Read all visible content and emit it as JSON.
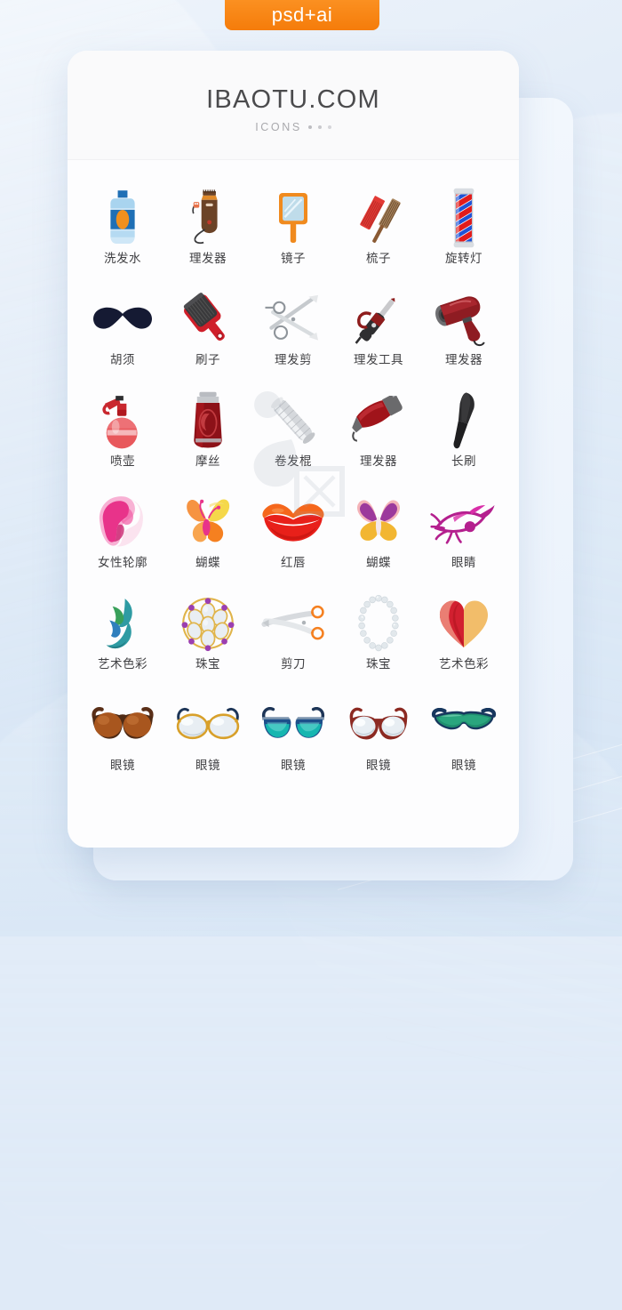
{
  "badge": {
    "label": "psd+ai",
    "color": "#f57c0a"
  },
  "card": {
    "title": "IBAOTU.COM",
    "subtitle": "ICONS"
  },
  "theme": {
    "background_top": "#eef4fb",
    "background_bottom": "#d3e3f4",
    "card_bg": "#fdfdfe",
    "label_color": "#3f3f42",
    "title_color": "#4b4b4d"
  },
  "grid": {
    "columns": 5,
    "rows": 6,
    "items": [
      {
        "label": "洗发水",
        "icon": "shampoo-bottle-icon",
        "colors": [
          "#1b6fb8",
          "#b9ddf5",
          "#f08a1e"
        ]
      },
      {
        "label": "理发器",
        "icon": "hair-clipper-icon",
        "colors": [
          "#6b4327",
          "#e08a2a",
          "#c0392b"
        ]
      },
      {
        "label": "镜子",
        "icon": "hand-mirror-icon",
        "colors": [
          "#f08a1e",
          "#bfdcea"
        ]
      },
      {
        "label": "梳子",
        "icon": "comb-pair-icon",
        "colors": [
          "#e23a35",
          "#8a5a34"
        ]
      },
      {
        "label": "旋转灯",
        "icon": "barber-pole-icon",
        "colors": [
          "#e21b1b",
          "#1f53d6",
          "#d9dde2"
        ]
      },
      {
        "label": "胡须",
        "icon": "mustache-icon",
        "colors": [
          "#151a33"
        ]
      },
      {
        "label": "刷子",
        "icon": "paddle-brush-icon",
        "colors": [
          "#cf1f2a",
          "#3a3a3c"
        ]
      },
      {
        "label": "理发剪",
        "icon": "shears-icon",
        "colors": [
          "#b9bcc1",
          "#e6e8ea"
        ]
      },
      {
        "label": "理发工具",
        "icon": "curling-iron-icon",
        "colors": [
          "#8e1c1c",
          "#3a3a3c"
        ]
      },
      {
        "label": "理发器",
        "icon": "hair-dryer-icon",
        "colors": [
          "#8e1c22",
          "#4a4a4c"
        ]
      },
      {
        "label": "喷壶",
        "icon": "spray-bottle-icon",
        "colors": [
          "#c9282f",
          "#e8585c"
        ]
      },
      {
        "label": "摩丝",
        "icon": "mousse-tube-icon",
        "colors": [
          "#8c1118",
          "#b9bcc1"
        ]
      },
      {
        "label": "卷发棍",
        "icon": "curling-rod-icon",
        "colors": [
          "#c6c9cd",
          "#eceef0"
        ]
      },
      {
        "label": "理发器",
        "icon": "clipper-red-icon",
        "colors": [
          "#a0141a",
          "#6a6a6c"
        ]
      },
      {
        "label": "长刷",
        "icon": "tint-brush-icon",
        "colors": [
          "#2a2a2c"
        ]
      },
      {
        "label": "女性轮廓",
        "icon": "female-silhouette-icon",
        "colors": [
          "#e8338a",
          "#f7a8cf",
          "#fce9f2"
        ]
      },
      {
        "label": "蝴蝶",
        "icon": "butterfly-warm-icon",
        "colors": [
          "#f5d84a",
          "#f58020",
          "#e8338a"
        ]
      },
      {
        "label": "红唇",
        "icon": "red-lips-icon",
        "colors": [
          "#e8201a",
          "#f5671c"
        ]
      },
      {
        "label": "蝴蝶",
        "icon": "butterfly-purple-icon",
        "colors": [
          "#9c3a9c",
          "#f2b632",
          "#f4b3b8"
        ]
      },
      {
        "label": "眼睛",
        "icon": "eye-lash-icon",
        "colors": [
          "#b41f8e",
          "#d92ea8"
        ]
      },
      {
        "label": "艺术色彩",
        "icon": "art-color-teal-icon",
        "colors": [
          "#2e9ba3",
          "#2f7fbd",
          "#39a05a"
        ]
      },
      {
        "label": "珠宝",
        "icon": "gem-brooch-icon",
        "colors": [
          "#e0b44a",
          "#e9eef3",
          "#9b3fb0"
        ]
      },
      {
        "label": "剪刀",
        "icon": "scissors-orange-icon",
        "colors": [
          "#f58020",
          "#d7dade"
        ]
      },
      {
        "label": "珠宝",
        "icon": "pearl-necklace-icon",
        "colors": [
          "#d8dfe4",
          "#f4f7f9"
        ]
      },
      {
        "label": "艺术色彩",
        "icon": "art-color-heart-icon",
        "colors": [
          "#d22030",
          "#ef8f7f",
          "#f2bd6a"
        ]
      },
      {
        "label": "眼镜",
        "icon": "sunglasses-brown-icon",
        "colors": [
          "#5a2f18",
          "#a8561e"
        ]
      },
      {
        "label": "眼镜",
        "icon": "eyeglasses-gold-icon",
        "colors": [
          "#d8a02a",
          "#1d3557",
          "#e8eef3"
        ]
      },
      {
        "label": "眼镜",
        "icon": "sunglasses-blue-icon",
        "colors": [
          "#1d4f8a",
          "#16b6b0"
        ]
      },
      {
        "label": "眼镜",
        "icon": "eyeglasses-red-icon",
        "colors": [
          "#8c2a22",
          "#e8eef3"
        ]
      },
      {
        "label": "眼镜",
        "icon": "sport-sunglasses-icon",
        "colors": [
          "#17375e",
          "#1f8f6e"
        ]
      }
    ]
  }
}
